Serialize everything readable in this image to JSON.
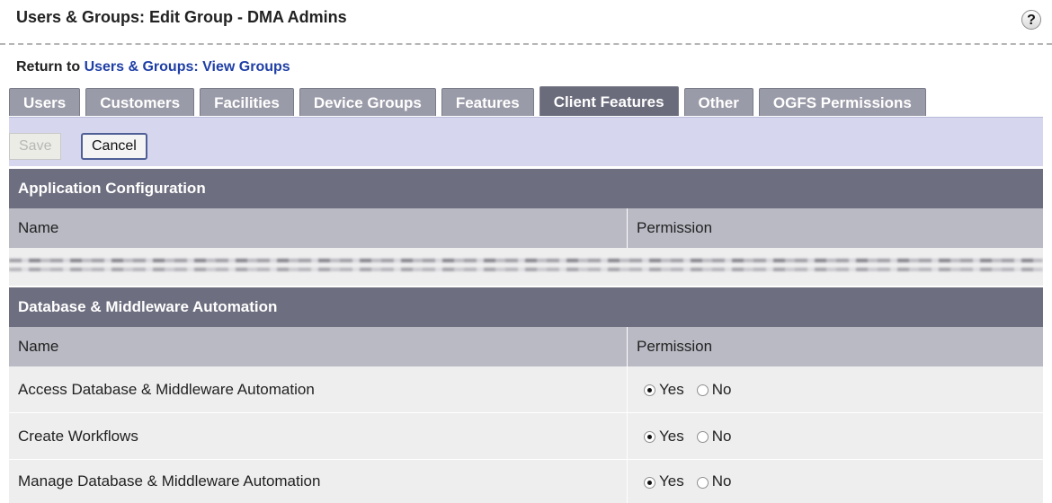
{
  "header": {
    "title": "Users & Groups: Edit Group - DMA Admins",
    "help_label": "?"
  },
  "return_link": {
    "prefix": "Return to",
    "link_text": "Users & Groups: View Groups"
  },
  "tabs": [
    {
      "label": "Users",
      "active": false
    },
    {
      "label": "Customers",
      "active": false
    },
    {
      "label": "Facilities",
      "active": false
    },
    {
      "label": "Device Groups",
      "active": false
    },
    {
      "label": "Features",
      "active": false
    },
    {
      "label": "Client Features",
      "active": true
    },
    {
      "label": "Other",
      "active": false
    },
    {
      "label": "OGFS Permissions",
      "active": false
    }
  ],
  "toolbar": {
    "save_label": "Save",
    "save_enabled": false,
    "cancel_label": "Cancel"
  },
  "sections": [
    {
      "title": "Application Configuration",
      "columns": {
        "name": "Name",
        "permission": "Permission"
      }
    },
    {
      "title": "Database & Middleware Automation",
      "columns": {
        "name": "Name",
        "permission": "Permission"
      },
      "rows": [
        {
          "name": "Access Database & Middleware Automation",
          "yes_label": "Yes",
          "no_label": "No",
          "selected": "Yes"
        },
        {
          "name": "Create Workflows",
          "yes_label": "Yes",
          "no_label": "No",
          "selected": "Yes"
        },
        {
          "name": "Manage Database & Middleware Automation",
          "yes_label": "Yes",
          "no_label": "No",
          "selected": "Yes"
        }
      ]
    }
  ],
  "colors": {
    "tab_bg": "#9a9ba8",
    "tab_active_bg": "#6a6c7c",
    "section_header_bg": "#6d6e7f",
    "column_header_bg": "#b9bac4",
    "toolbar_bg": "#d6d7ee",
    "link": "#1f3fa6"
  }
}
